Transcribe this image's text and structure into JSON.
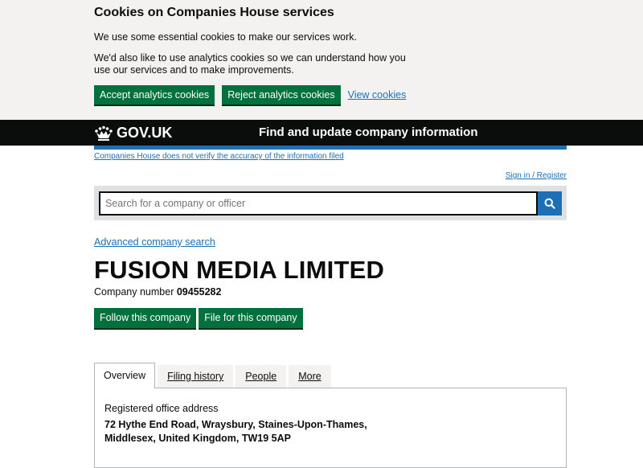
{
  "cookie_banner": {
    "title": "Cookies on Companies House services",
    "text1": "We use some essential cookies to make our services work.",
    "text2": "We'd also like to use analytics cookies so we can understand how you use our services and to make improvements.",
    "accept_label": "Accept analytics cookies",
    "reject_label": "Reject analytics cookies",
    "view_label": "View cookies"
  },
  "header": {
    "logo_text": "GOV.UK",
    "service_name": "Find and update company information",
    "logo_icon": "crown-icon"
  },
  "phase_note": "Companies House does not verify the accuracy of the information filed",
  "signin_label": "Sign in / Register",
  "search": {
    "placeholder": "Search for a company or officer",
    "button_icon": "search-icon"
  },
  "advanced_search_label": "Advanced company search",
  "company": {
    "name": "FUSION MEDIA LIMITED",
    "number_label": "Company number",
    "number": "09455282"
  },
  "actions": {
    "follow_label": "Follow this company",
    "file_label": "File for this company"
  },
  "tabs": [
    {
      "label": "Overview",
      "active": true
    },
    {
      "label": "Filing history",
      "active": false
    },
    {
      "label": "People",
      "active": false
    },
    {
      "label": "More",
      "active": false
    }
  ],
  "overview": {
    "address_label": "Registered office address",
    "address_value": "72 Hythe End Road, Wraysbury, Staines-Upon-Thames, Middlesex, United Kingdom, TW19 5AP"
  },
  "colors": {
    "green": "#00703c",
    "blue": "#1d70b8",
    "black": "#0b0c0c",
    "banner_bg": "#f3f2f1"
  }
}
